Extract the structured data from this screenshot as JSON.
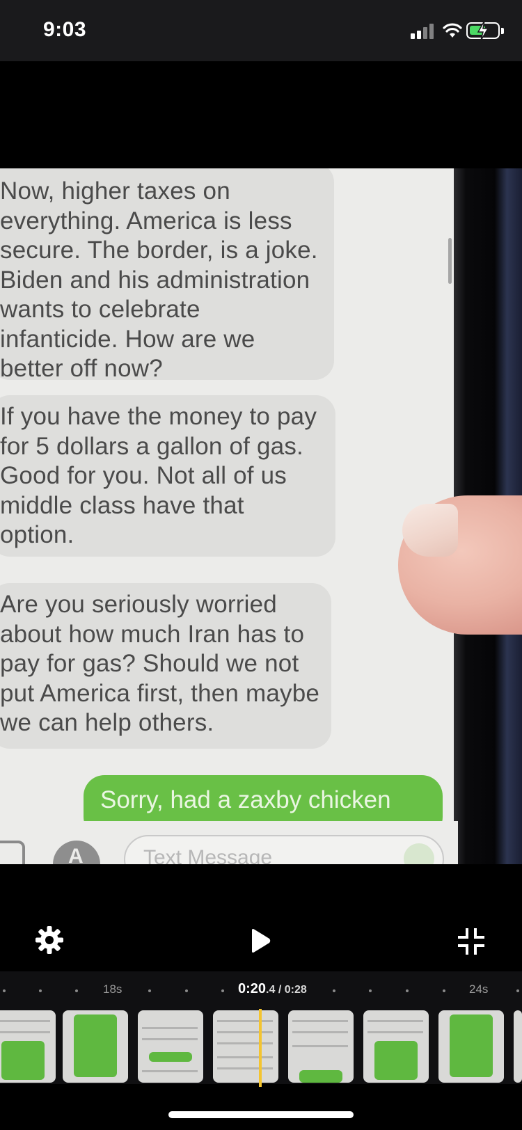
{
  "status_bar": {
    "time": "9:03",
    "signal_icon": "cellular-signal-icon",
    "wifi_icon": "wifi-icon",
    "battery_icon": "battery-charging-icon",
    "battery_color": "#4cd964"
  },
  "video": {
    "messages": [
      {
        "text": "Now, higher taxes on everything. America is less secure. The border, is a joke. Biden and his administration wants to celebrate infanticide. How are we better off now?"
      },
      {
        "text": "If you have the money to pay for 5 dollars a gallon of gas. Good for you. Not all of us middle class have that option."
      },
      {
        "text": "Are you seriously worried about how much Iran has to pay for gas? Should we not put America first, then maybe we can help others."
      }
    ],
    "sent_message": "Sorry, had a zaxby chicken",
    "input_placeholder": "Text Message",
    "sent_color": "#69c046"
  },
  "controls": {
    "settings_icon": "gear-icon",
    "play_icon": "play-icon",
    "exit_fullscreen_icon": "exit-fullscreen-icon"
  },
  "timeline": {
    "left_label": "18s",
    "current_whole": "0:20",
    "current_fraction": ".4",
    "separator": "/",
    "total": "0:28",
    "right_label": "24s",
    "playhead_color": "#f4c430"
  }
}
